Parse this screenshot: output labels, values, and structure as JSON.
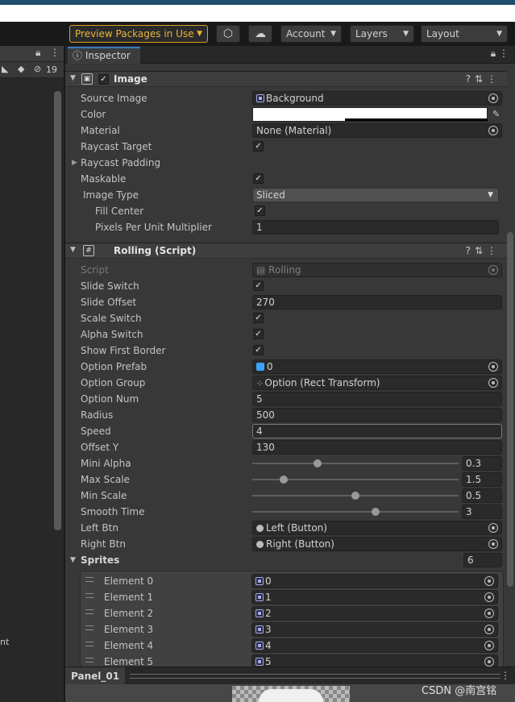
{
  "toolbar": {
    "preview_packages": "Preview Packages in Use",
    "account": "Account",
    "layers": "Layers",
    "layout": "Layout"
  },
  "left_panel": {
    "count": "19",
    "partial_text": "nt"
  },
  "inspector": {
    "tab_label": "Inspector",
    "image_component": {
      "title": "Image",
      "enabled": true,
      "rows": [
        {
          "label": "Source Image",
          "value": "Background"
        },
        {
          "label": "Color",
          "value": ""
        },
        {
          "label": "Material",
          "value": "None (Material)"
        },
        {
          "label": "Raycast Target",
          "checked": true
        },
        {
          "label": "Raycast Padding"
        },
        {
          "label": "Maskable",
          "checked": true
        },
        {
          "label": "Image Type",
          "value": "Sliced"
        },
        {
          "label": "Fill Center",
          "checked": true
        },
        {
          "label": "Pixels Per Unit Multiplier",
          "value": "1"
        }
      ],
      "color_hex": "#ffffff"
    },
    "rolling_component": {
      "title": "Rolling (Script)",
      "script": {
        "label": "Script",
        "value": "Rolling"
      },
      "slide_switch": {
        "label": "Slide Switch",
        "checked": true
      },
      "slide_offset": {
        "label": "Slide Offset",
        "value": "270"
      },
      "scale_switch": {
        "label": "Scale Switch",
        "checked": true
      },
      "alpha_switch": {
        "label": "Alpha Switch",
        "checked": true
      },
      "show_first_border": {
        "label": "Show First Border",
        "checked": true
      },
      "option_prefab": {
        "label": "Option Prefab",
        "value": "0"
      },
      "option_group": {
        "label": "Option Group",
        "value": "Option (Rect Transform)"
      },
      "option_num": {
        "label": "Option Num",
        "value": "5"
      },
      "radius": {
        "label": "Radius",
        "value": "500"
      },
      "speed": {
        "label": "Speed",
        "value": "4"
      },
      "offset_y": {
        "label": "Offset Y",
        "value": "130"
      },
      "mini_alpha": {
        "label": "Mini Alpha",
        "value": "0.3",
        "fraction": 0.31
      },
      "max_scale": {
        "label": "Max Scale",
        "value": "1.5",
        "fraction": 0.14
      },
      "min_scale": {
        "label": "Min Scale",
        "value": "0.5",
        "fraction": 0.5
      },
      "smooth_time": {
        "label": "Smooth Time",
        "value": "3",
        "fraction": 0.6
      },
      "left_btn": {
        "label": "Left Btn",
        "value": "Left (Button)"
      },
      "right_btn": {
        "label": "Right Btn",
        "value": "Right (Button)"
      },
      "sprites": {
        "label": "Sprites",
        "count": "6",
        "elements": [
          {
            "label": "Element 0",
            "value": "0"
          },
          {
            "label": "Element 1",
            "value": "1"
          },
          {
            "label": "Element 2",
            "value": "2"
          },
          {
            "label": "Element 3",
            "value": "3"
          },
          {
            "label": "Element 4",
            "value": "4"
          },
          {
            "label": "Element 5",
            "value": "5"
          }
        ]
      }
    }
  },
  "bottom_bar": {
    "panel_label": "Panel_01"
  },
  "watermark": "CSDN @南宫铭",
  "colors": {
    "accent_tab": "#3a79bb",
    "preview_packages": "#e8b53a"
  }
}
